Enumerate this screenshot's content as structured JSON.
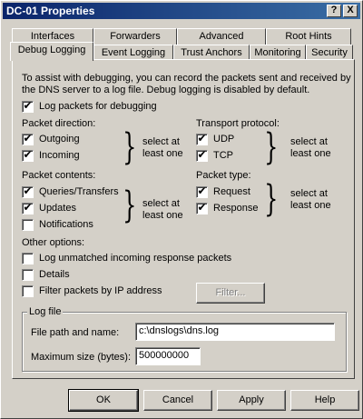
{
  "window": {
    "title": "DC-01 Properties",
    "help_btn": "?",
    "close_btn": "X"
  },
  "tabs_row1": [
    {
      "label": "Interfaces"
    },
    {
      "label": "Forwarders"
    },
    {
      "label": "Advanced"
    },
    {
      "label": "Root Hints"
    }
  ],
  "tabs_row2": [
    {
      "label": "Debug Logging",
      "active": true
    },
    {
      "label": "Event Logging"
    },
    {
      "label": "Trust Anchors"
    },
    {
      "label": "Monitoring"
    },
    {
      "label": "Security"
    }
  ],
  "panel": {
    "description_line1": "To assist with debugging, you can record the packets sent and received by",
    "description_line2": "the DNS server to a log file. Debug logging is disabled by default.",
    "log_packets": {
      "label": "Log packets for debugging",
      "checked": true
    },
    "packet_direction": {
      "heading": "Packet direction:",
      "outgoing": {
        "label": "Outgoing",
        "checked": true
      },
      "incoming": {
        "label": "Incoming",
        "checked": true
      },
      "hint_line1": "select at",
      "hint_line2": "least one"
    },
    "transport_protocol": {
      "heading": "Transport protocol:",
      "udp": {
        "label": "UDP",
        "checked": true
      },
      "tcp": {
        "label": "TCP",
        "checked": true
      },
      "hint_line1": "select at",
      "hint_line2": "least one"
    },
    "packet_contents": {
      "heading": "Packet contents:",
      "queries": {
        "label": "Queries/Transfers",
        "checked": true
      },
      "updates": {
        "label": "Updates",
        "checked": true
      },
      "notifications": {
        "label": "Notifications",
        "checked": false
      },
      "hint_line1": "select at",
      "hint_line2": "least one"
    },
    "packet_type": {
      "heading": "Packet type:",
      "request": {
        "label": "Request",
        "checked": true
      },
      "response": {
        "label": "Response",
        "checked": true
      },
      "hint_line1": "select at",
      "hint_line2": "least one"
    },
    "other_options": {
      "heading": "Other options:",
      "log_unmatched": {
        "label": "Log unmatched incoming response packets",
        "checked": false
      },
      "details": {
        "label": "Details",
        "checked": false
      },
      "filter_ip": {
        "label": "Filter packets by IP address",
        "checked": false
      },
      "filter_button": "Filter..."
    },
    "log_file": {
      "legend": "Log file",
      "path_label": "File path and name:",
      "path_value": "c:\\dnslogs\\dns.log",
      "size_label": "Maximum size (bytes):",
      "size_value": "500000000"
    }
  },
  "buttons": {
    "ok": "OK",
    "cancel": "Cancel",
    "apply": "Apply",
    "help": "Help"
  },
  "check_glyph": "✔"
}
